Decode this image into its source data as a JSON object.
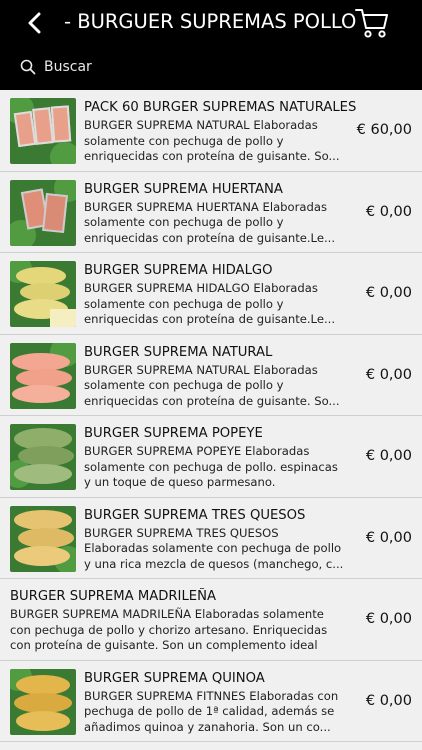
{
  "header": {
    "title": "- BURGUER SUPREMAS POLLO",
    "back_icon": "chevron-left-icon",
    "cart_icon": "cart-icon"
  },
  "search": {
    "label": "Buscar",
    "icon": "search-icon"
  },
  "products": [
    {
      "name": "PACK 60 BURGER SUPREMAS NATURALES",
      "desc": "BURGER SUPREMA NATURAL Elaboradas solamente con pechuga de pollo y enriquecidas con proteína de guisante. So...",
      "price": "€ 60,00",
      "has_image": true
    },
    {
      "name": "BURGER SUPREMA HUERTANA",
      "desc": "BURGER SUPREMA HUERTANA  Elaboradas solamente con pechuga de pollo y enriquecidas con proteína de guisante.Le...",
      "price": "€ 0,00",
      "has_image": true
    },
    {
      "name": "BURGER SUPREMA HIDALGO",
      "desc": "BURGER SUPREMA HIDALGO  Elaboradas solamente con pechuga de pollo y enriquecidas con proteína de guisante.Le...",
      "price": "€ 0,00",
      "has_image": true
    },
    {
      "name": "BURGER SUPREMA NATURAL",
      "desc": "BURGER SUPREMA NATURAL Elaboradas solamente con pechuga de pollo y enriquecidas con proteína de guisante. So...",
      "price": "€ 0,00",
      "has_image": true
    },
    {
      "name": "BURGER SUPREMA POPEYE",
      "desc": "BURGER SUPREMA POPEYE  Elaboradas solamente con pechuga de pollo. espinacas y un toque de queso parmesano. Enriqueci...",
      "price": "€ 0,00",
      "has_image": true
    },
    {
      "name": "BURGER SUPREMA TRES QUESOS",
      "desc": "BURGER SUPREMA TRES QUESOS Elaboradas solamente con pechuga de pollo y una rica mezcla de quesos (manchego, c...",
      "price": "€ 0,00",
      "has_image": true
    },
    {
      "name": "BURGER SUPREMA MADRILEÑA",
      "desc": "BURGER SUPREMA MADRILEÑA  Elaboradas solamente con pechuga de pollo y chorizo artesano. Enriquecidas con proteína de guisante. Son un complemento ideal p...",
      "price": "€ 0,00",
      "has_image": false
    },
    {
      "name": "BURGER SUPREMA QUINOA",
      "desc": "BURGER SUPREMA FITNNES  Elaboradas con pechuga de pollo de 1ª calidad, además se añadimos quinoa y zanahoria. Son un co...",
      "price": "€ 0,00",
      "has_image": true
    }
  ],
  "colors": {
    "header_bg": "#000000",
    "list_bg": "#f0f0f0"
  }
}
